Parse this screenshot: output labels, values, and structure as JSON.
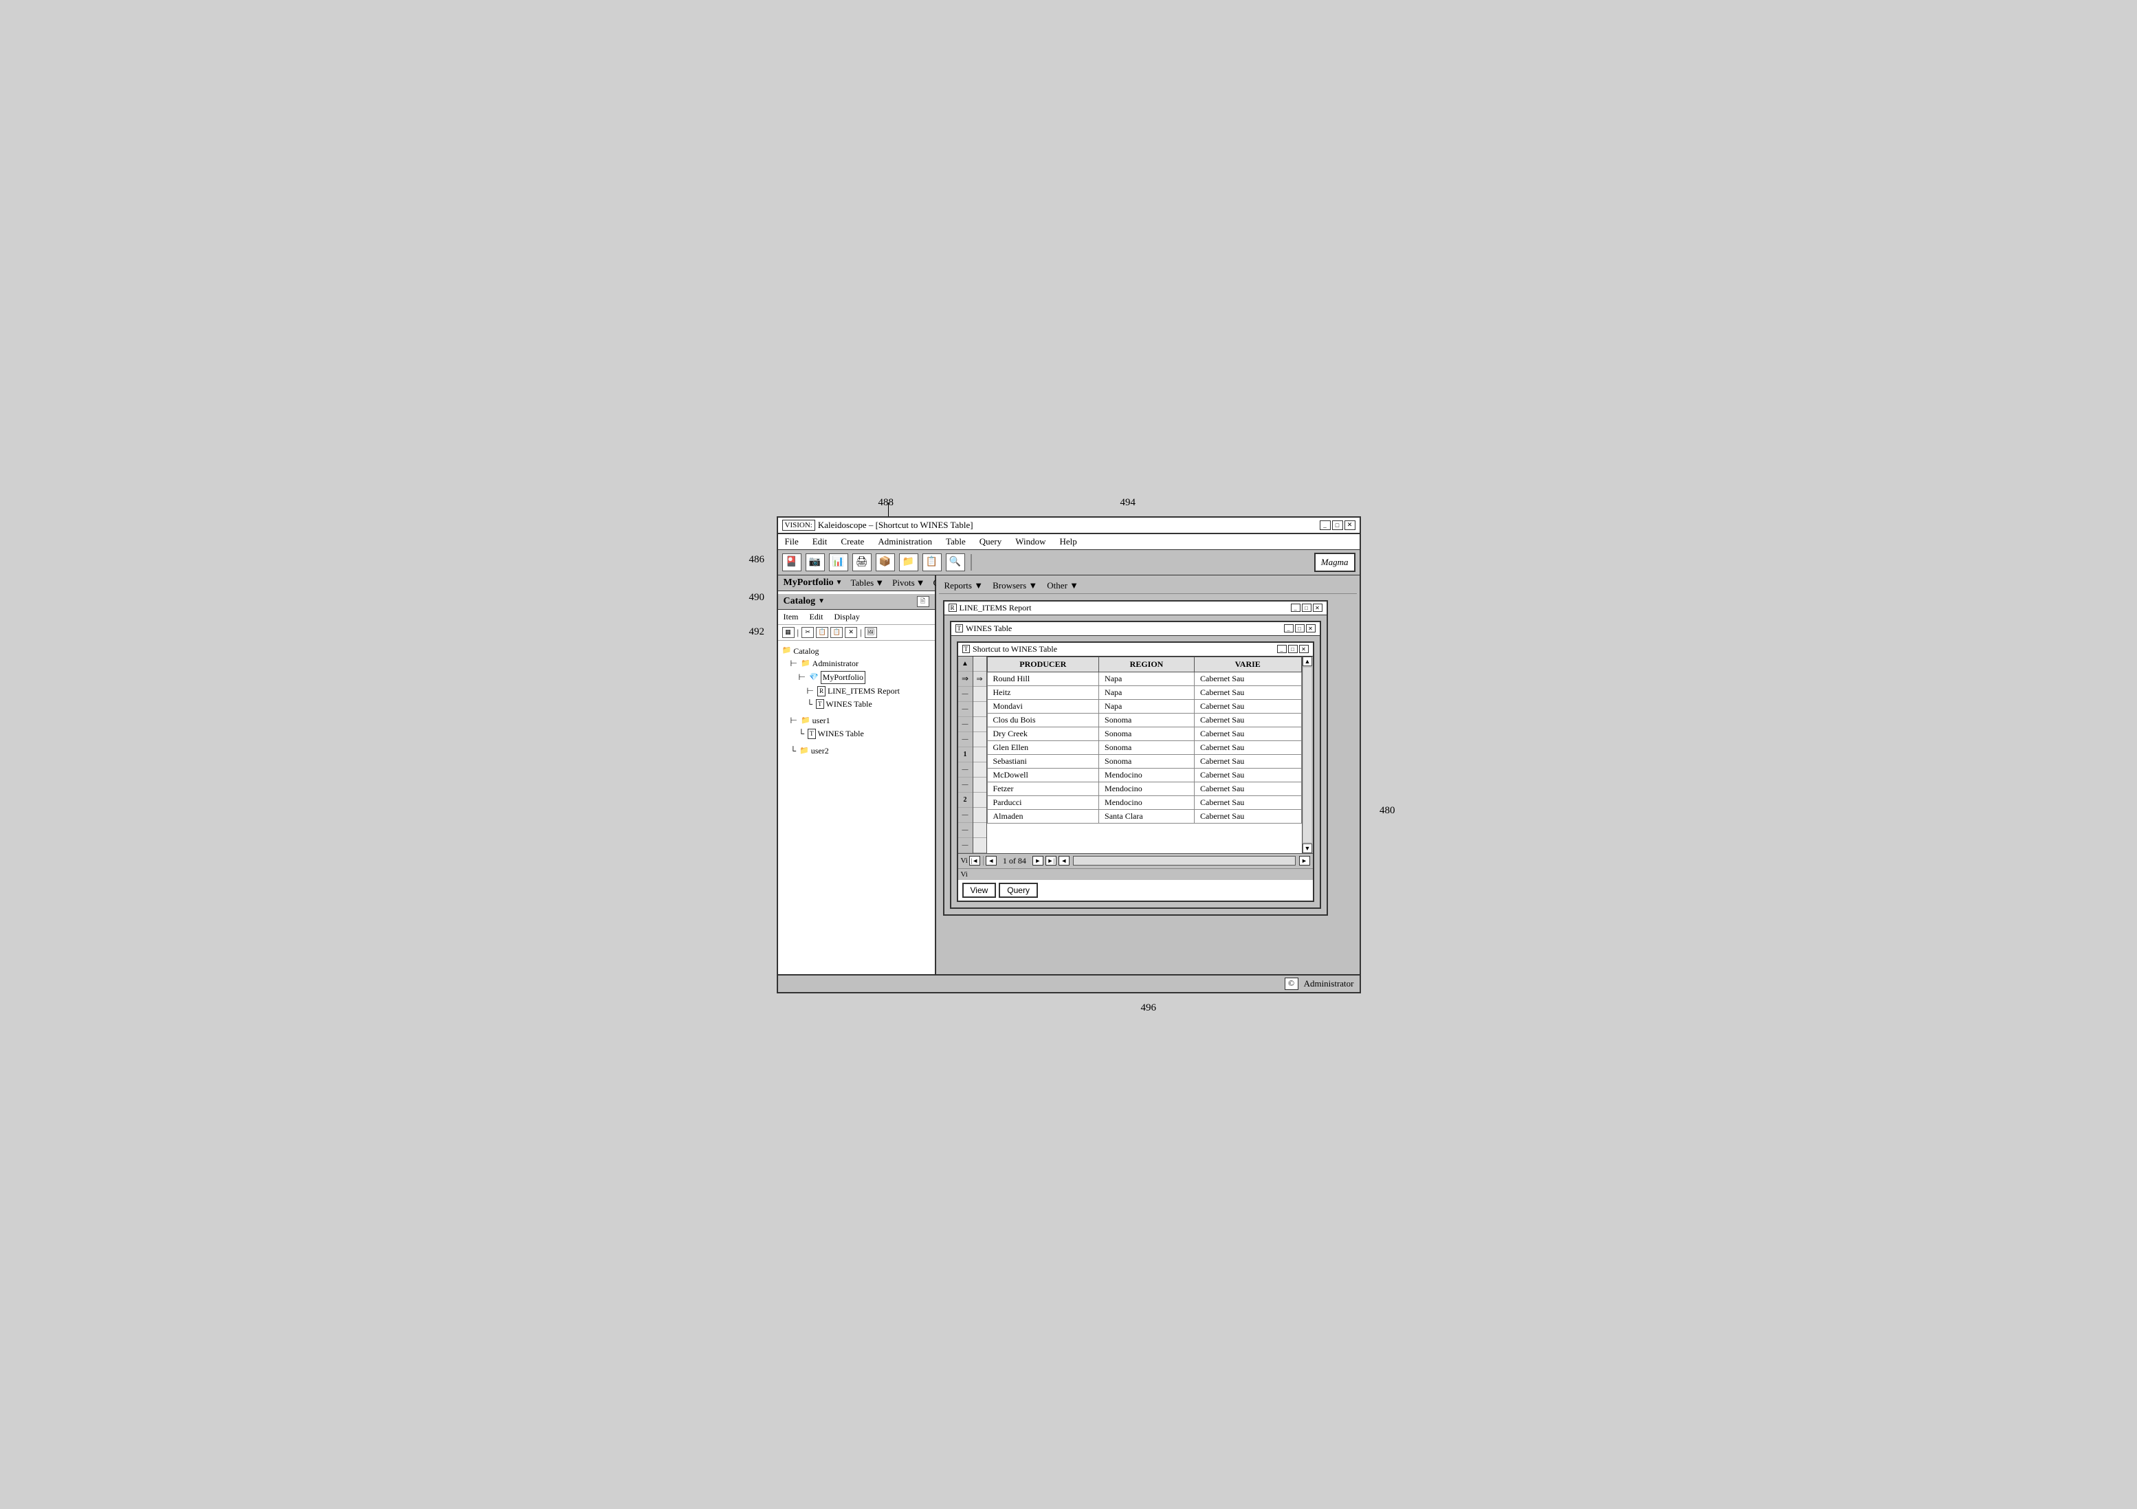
{
  "annotations": {
    "top_number": "488",
    "left_486": "486",
    "left_490": "490",
    "left_492": "492",
    "center_494": "494",
    "center_488": "488",
    "right_480": "480",
    "bottom_496": "496"
  },
  "app": {
    "title_prefix": "VISION:",
    "title_main": "Kaleidoscope – [Shortcut to WINES Table]",
    "logo_text": "Magma",
    "menu_items": [
      "File",
      "Edit",
      "Create",
      "Administration",
      "Table",
      "Query",
      "Window",
      "Help"
    ],
    "toolbar_label": "488"
  },
  "catalog": {
    "title": "Catalog",
    "dropdown_arrow": "▼",
    "menu_items": [
      "Item",
      "Edit",
      "Display"
    ],
    "tree": [
      {
        "label": "Catalog",
        "icon": "📁",
        "indent": 0
      },
      {
        "label": "Administrator",
        "icon": "📁",
        "indent": 1
      },
      {
        "label": "MyPortfolio",
        "icon": "💎",
        "indent": 2,
        "highlighted": true
      },
      {
        "label": "LINE_ITEMS Report",
        "icon": "R",
        "indent": 3
      },
      {
        "label": "WINES Table",
        "icon": "T",
        "indent": 3
      },
      {
        "label": "user1",
        "icon": "📁",
        "indent": 1
      },
      {
        "label": "WINES Table",
        "icon": "T",
        "indent": 2
      },
      {
        "label": "user2",
        "icon": "📁",
        "indent": 1
      }
    ]
  },
  "portfolio": {
    "name": "MyPortfolio",
    "dropdown_arrow": "▼",
    "menu_items": [
      {
        "label": "Tables",
        "arrow": "▼"
      },
      {
        "label": "Pivots",
        "arrow": "▼"
      },
      {
        "label": "Graphs",
        "arrow": "▼"
      },
      {
        "label": "Reports",
        "arrow": "▼"
      },
      {
        "label": "Browsers",
        "arrow": "▼"
      },
      {
        "label": "Other",
        "arrow": "▼"
      }
    ]
  },
  "line_items_window": {
    "title": "LINE_ITEMS Report",
    "icon": "R"
  },
  "wines_table_window": {
    "title": "WINES Table",
    "icon": "T"
  },
  "shortcut_window": {
    "title": "Shortcut to WINES Table",
    "icon": "T",
    "columns": [
      "PRODUCER",
      "REGION",
      "VARIE"
    ],
    "rows": [
      {
        "producer": "Round Hill",
        "region": "Napa",
        "variety": "Cabernet Sau",
        "arrow": true
      },
      {
        "producer": "Heitz",
        "region": "Napa",
        "variety": "Cabernet Sau"
      },
      {
        "producer": "Mondavi",
        "region": "Napa",
        "variety": "Cabernet Sau"
      },
      {
        "producer": "Clos du Bois",
        "region": "Sonoma",
        "variety": "Cabernet Sau"
      },
      {
        "producer": "Dry Creek",
        "region": "Sonoma",
        "variety": "Cabernet Sau"
      },
      {
        "producer": "Glen Ellen",
        "region": "Sonoma",
        "variety": "Cabernet Sau"
      },
      {
        "producer": "Sebastiani",
        "region": "Sonoma",
        "variety": "Cabernet Sau"
      },
      {
        "producer": "McDowell",
        "region": "Mendocino",
        "variety": "Cabernet Sau"
      },
      {
        "producer": "Fetzer",
        "region": "Mendocino",
        "variety": "Cabernet Sau"
      },
      {
        "producer": "Parducci",
        "region": "Mendocino",
        "variety": "Cabernet Sau"
      },
      {
        "producer": "Almaden",
        "region": "Santa Clara",
        "variety": "Cabernet Sau"
      }
    ],
    "nav": {
      "page_of": "1 of 84"
    },
    "tabs": [
      "View",
      "Query"
    ]
  },
  "row_labels": [
    "-",
    "-",
    "-",
    "-",
    "1",
    "-",
    "-",
    "-",
    "2",
    "-",
    "-",
    "-"
  ],
  "status_bar": {
    "label": "Administrator",
    "icon": "©"
  }
}
